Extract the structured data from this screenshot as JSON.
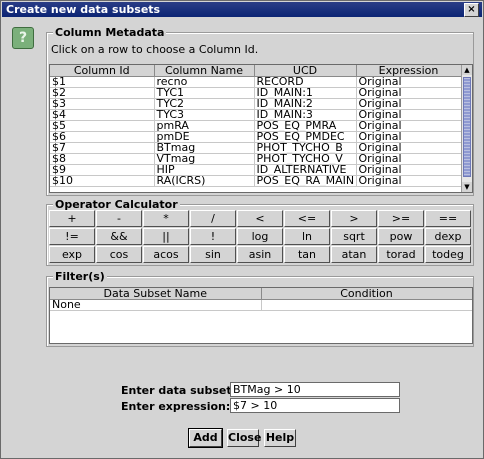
{
  "window": {
    "title": "Create new data subsets",
    "close_glyph": "×"
  },
  "icons": {
    "help": "?"
  },
  "metadata": {
    "title": "Column Metadata",
    "hint": "Click on a row to choose a Column Id.",
    "columns": [
      "Column Id",
      "Column Name",
      "UCD",
      "Expression"
    ],
    "rows": [
      [
        "$1",
        "recno",
        "RECORD",
        "Original"
      ],
      [
        "$2",
        "TYC1",
        "ID_MAIN:1",
        "Original"
      ],
      [
        "$3",
        "TYC2",
        "ID_MAIN:2",
        "Original"
      ],
      [
        "$4",
        "TYC3",
        "ID_MAIN:3",
        "Original"
      ],
      [
        "$5",
        "pmRA",
        "POS_EQ_PMRA",
        "Original"
      ],
      [
        "$6",
        "pmDE",
        "POS_EQ_PMDEC",
        "Original"
      ],
      [
        "$7",
        "BTmag",
        "PHOT_TYCHO_B",
        "Original"
      ],
      [
        "$8",
        "VTmag",
        "PHOT_TYCHO_V",
        "Original"
      ],
      [
        "$9",
        "HIP",
        "ID_ALTERNATIVE",
        "Original"
      ],
      [
        "$10",
        "RA(ICRS)",
        "POS_EQ_RA_MAIN",
        "Original"
      ]
    ]
  },
  "calculator": {
    "title": "Operator Calculator",
    "rows": [
      [
        "+",
        "-",
        "*",
        "/",
        "<",
        "<=",
        ">",
        ">=",
        "=="
      ],
      [
        "!=",
        "&&",
        "||",
        "!",
        "log",
        "ln",
        "sqrt",
        "pow",
        "dexp"
      ],
      [
        "exp",
        "cos",
        "acos",
        "sin",
        "asin",
        "tan",
        "atan",
        "torad",
        "todeg"
      ]
    ]
  },
  "filters": {
    "title": "Filter(s)",
    "columns": [
      "Data Subset Name",
      "Condition"
    ],
    "rows": [
      [
        "None",
        ""
      ]
    ]
  },
  "form": {
    "name_label": "Enter data subset name:",
    "name_value": "BTMag > 10",
    "expr_label": "Enter expression:",
    "expr_value": "$7 > 10"
  },
  "buttons": {
    "add": "Add",
    "close": "Close",
    "help": "Help"
  }
}
